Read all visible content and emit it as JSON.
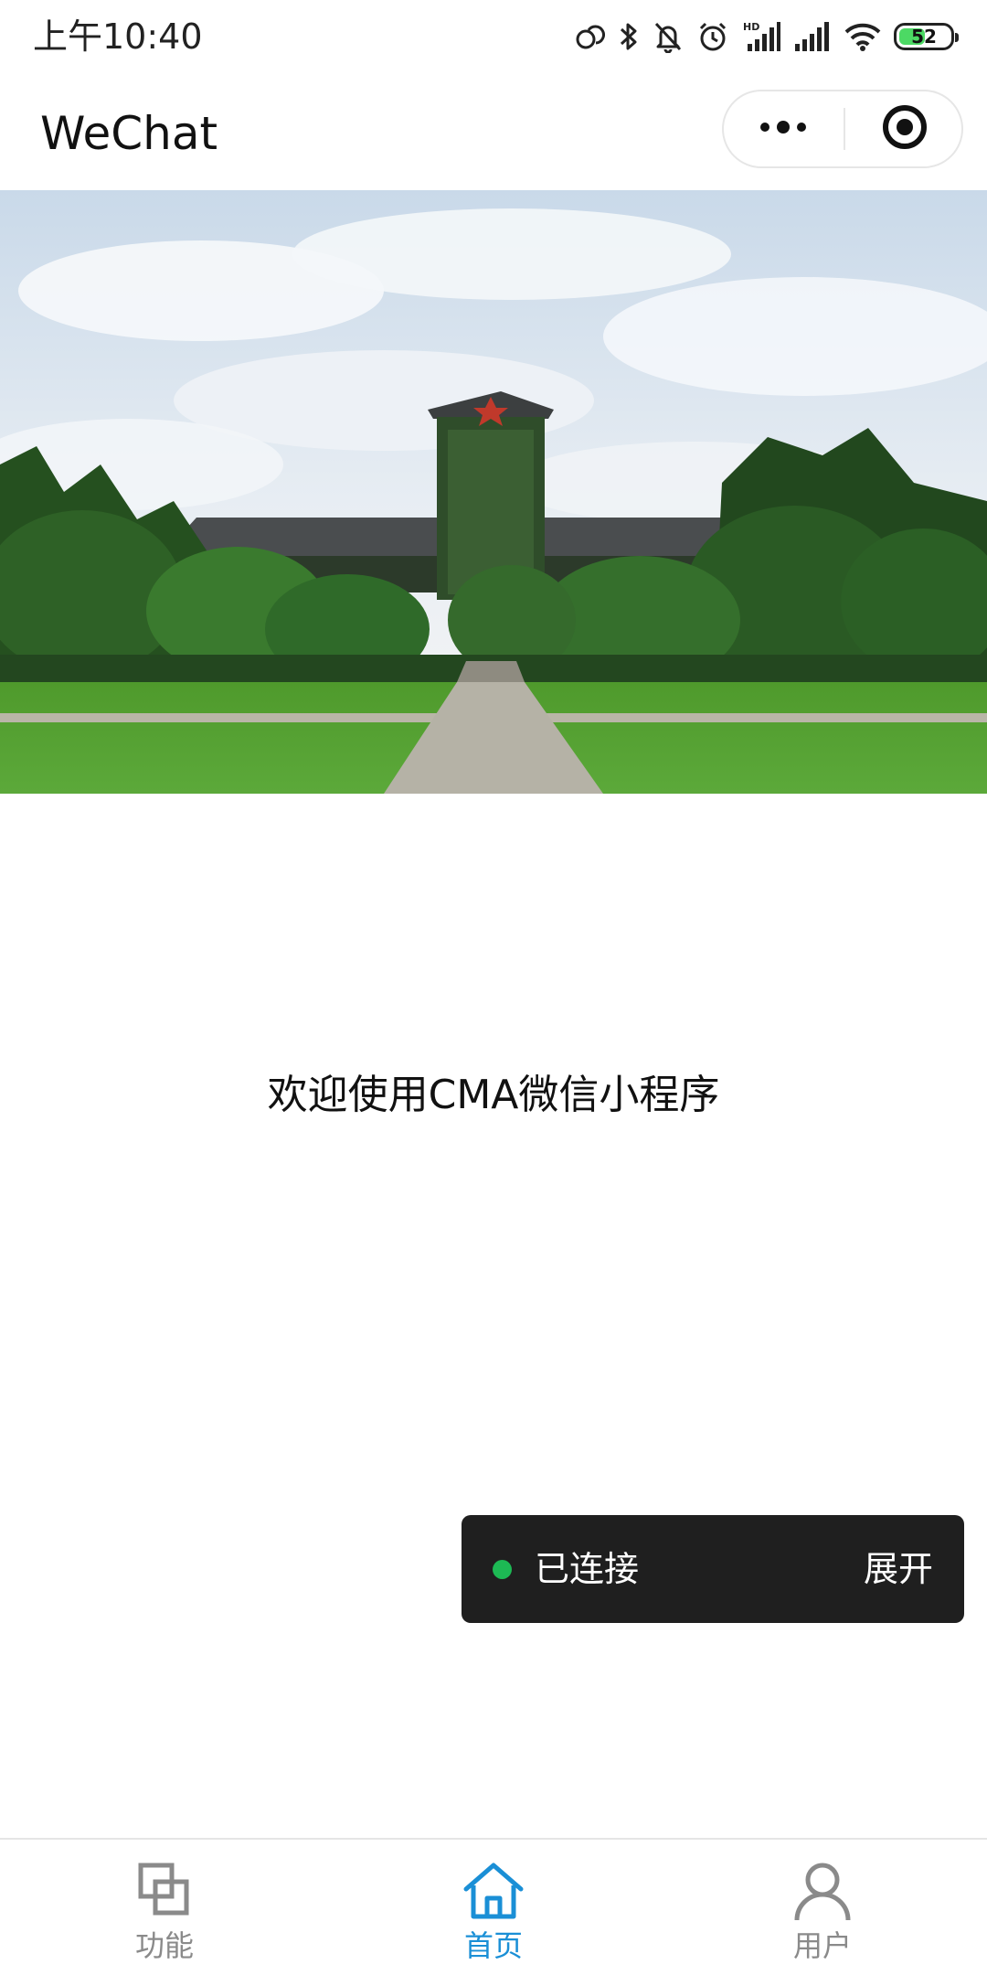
{
  "status_bar": {
    "time": "上午10:40",
    "battery_level": "52",
    "battery_fraction": 0.52,
    "icons": [
      "link-icon",
      "bluetooth-icon",
      "mute-bell-icon",
      "alarm-icon",
      "hd-signal-icon",
      "signal-icon",
      "wifi-icon",
      "battery-icon"
    ],
    "hd_label": "HD"
  },
  "nav": {
    "title": "WeChat",
    "more_icon": "more-dots-icon",
    "close_icon": "target-close-icon"
  },
  "banner": {
    "description_icon": "campus-building-photo"
  },
  "main": {
    "welcome_text": "欢迎使用CMA微信小程序"
  },
  "connection": {
    "status_label": "已连接",
    "expand_label": "展开",
    "status_color": "#1db954"
  },
  "tabs": [
    {
      "label": "功能",
      "icon": "function-squares-icon",
      "active": false
    },
    {
      "label": "首页",
      "icon": "home-icon",
      "active": true
    },
    {
      "label": "用户",
      "icon": "user-icon",
      "active": false
    }
  ],
  "colors": {
    "accent": "#1a8fd6",
    "inactive": "#8a8a8a",
    "toast_bg": "#1f1f1f",
    "connected": "#1db954"
  }
}
